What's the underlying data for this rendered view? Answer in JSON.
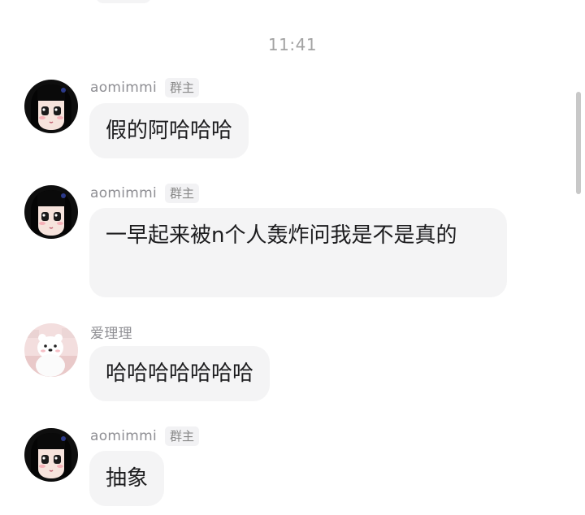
{
  "timestamp": "11:41",
  "messages": [
    {
      "user": "aomimmi",
      "badge": "群主",
      "text": "假的阿哈哈哈",
      "avatar": "girl-black-hair-avatar"
    },
    {
      "user": "aomimmi",
      "badge": "群主",
      "text": "一早起来被n个人轰炸问我是不是真的",
      "avatar": "girl-black-hair-avatar"
    },
    {
      "user": "爱理理",
      "badge": "",
      "text": "哈哈哈哈哈哈哈",
      "avatar": "white-bear-avatar"
    },
    {
      "user": "aomimmi",
      "badge": "群主",
      "text": "抽象",
      "avatar": "girl-black-hair-avatar"
    }
  ],
  "colors": {
    "bubble_bg": "#f4f4f5",
    "text": "#1c1c1e",
    "meta": "#8e8e93"
  }
}
